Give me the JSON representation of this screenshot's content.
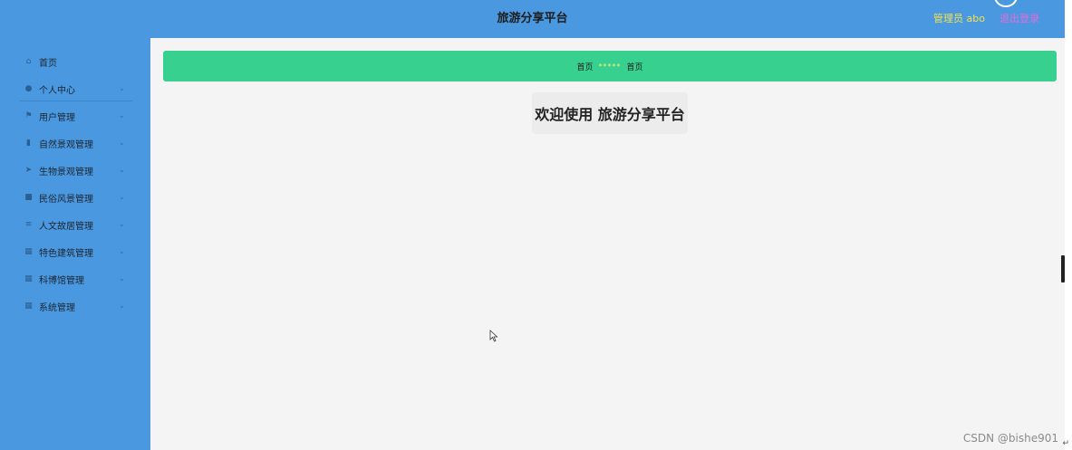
{
  "header": {
    "title": "旅游分享平台",
    "admin_label": "管理员 abo",
    "logout_label": "退出登录"
  },
  "sidebar": {
    "items": [
      {
        "label": "首页",
        "icon": "home-icon",
        "glyph": "⌂",
        "has_chevron": false
      },
      {
        "label": "个人中心",
        "icon": "user-icon",
        "glyph": "●",
        "has_chevron": true
      },
      {
        "label": "用户管理",
        "icon": "flag-icon",
        "glyph": "⚑",
        "has_chevron": true
      },
      {
        "label": "自然景观管理",
        "icon": "chart-icon",
        "glyph": "▮",
        "has_chevron": true
      },
      {
        "label": "生物景观管理",
        "icon": "send-icon",
        "glyph": "➤",
        "has_chevron": true
      },
      {
        "label": "民俗风景管理",
        "icon": "message-icon",
        "glyph": "■",
        "has_chevron": true
      },
      {
        "label": "人文故居管理",
        "icon": "list-icon",
        "glyph": "≡",
        "has_chevron": true
      },
      {
        "label": "特色建筑管理",
        "icon": "grid-icon",
        "glyph": "▦",
        "has_chevron": true
      },
      {
        "label": "科博馆管理",
        "icon": "grid-icon",
        "glyph": "▦",
        "has_chevron": true
      },
      {
        "label": "系统管理",
        "icon": "grid-icon",
        "glyph": "▦",
        "has_chevron": true
      }
    ]
  },
  "breadcrumb": {
    "first": "首页",
    "separator": "*****",
    "second": "首页"
  },
  "welcome": {
    "text": "欢迎使用 旅游分享平台"
  },
  "watermark": "CSDN @bishe901",
  "colors": {
    "header_bg": "#4a98df",
    "sidebar_bg": "#4a98df",
    "breadcrumb_bg": "#37d08f",
    "admin_text": "#f1e34b",
    "logout_text": "#e96ad8"
  }
}
